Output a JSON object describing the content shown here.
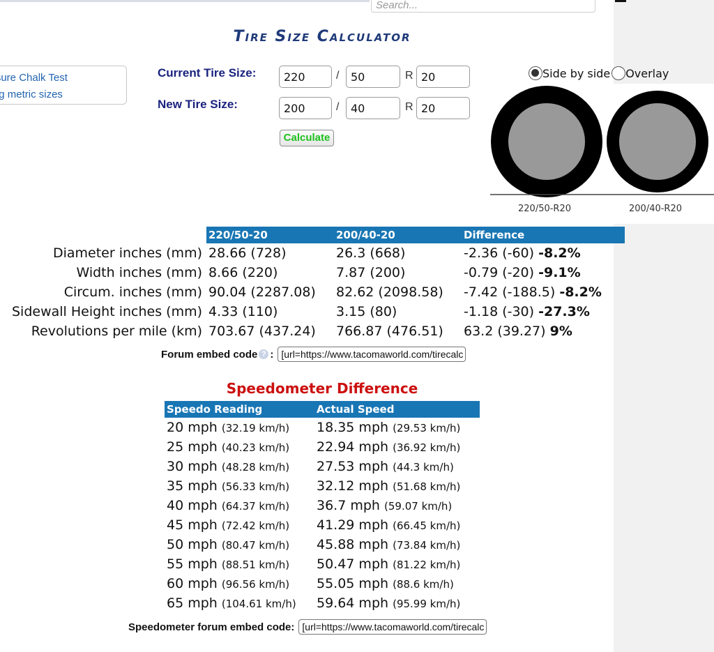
{
  "search": {
    "placeholder": "Search..."
  },
  "title": "Tire Size Calculator",
  "links": [
    "Pressure Chalk Test",
    "Understanding metric sizes"
  ],
  "form": {
    "current_label": "Current Tire Size:",
    "new_label": "New Tire Size:",
    "separator_slash": "/",
    "separator_r": "R",
    "current": {
      "width": "220",
      "aspect": "50",
      "rim": "20"
    },
    "new": {
      "width": "200",
      "aspect": "40",
      "rim": "20"
    },
    "calculate_label": "Calculate"
  },
  "view": {
    "side_by_side": "Side by side",
    "overlay": "Overlay",
    "selected": "side_by_side"
  },
  "tire_images": {
    "current_caption": "220/50-R20",
    "new_caption": "200/40-R20"
  },
  "comparison": {
    "headers": [
      "220/50-20",
      "200/40-20",
      "Difference"
    ],
    "rows": [
      {
        "label": "Diameter inches (mm)",
        "current": "28.66 (728)",
        "new": "26.3 (668)",
        "diff": "-2.36 (-60)",
        "pct": "-8.2%"
      },
      {
        "label": "Width inches (mm)",
        "current": "8.66 (220)",
        "new": "7.87 (200)",
        "diff": "-0.79 (-20)",
        "pct": "-9.1%"
      },
      {
        "label": "Circum. inches (mm)",
        "current": "90.04 (2287.08)",
        "new": "82.62 (2098.58)",
        "diff": "-7.42 (-188.5)",
        "pct": "-8.2%"
      },
      {
        "label": "Sidewall Height inches (mm)",
        "current": "4.33 (110)",
        "new": "3.15 (80)",
        "diff": "-1.18 (-30)",
        "pct": "-27.3%"
      },
      {
        "label": "Revolutions per mile (km)",
        "current": "703.67 (437.24)",
        "new": "766.87 (476.51)",
        "diff": "63.2 (39.27)",
        "pct": "9%"
      }
    ]
  },
  "forum_embed": {
    "label": "Forum embed code",
    "help": "?",
    "colon": ":",
    "value": "[url=https://www.tacomaworld.com/tirecalc"
  },
  "speedo": {
    "title": "Speedometer Difference",
    "headers": [
      "Speedo Reading",
      "Actual Speed"
    ],
    "rows": [
      {
        "reading": "20 mph",
        "reading_km": "(32.19 km/h)",
        "actual": "18.35 mph",
        "actual_km": "(29.53 km/h)"
      },
      {
        "reading": "25 mph",
        "reading_km": "(40.23 km/h)",
        "actual": "22.94 mph",
        "actual_km": "(36.92 km/h)"
      },
      {
        "reading": "30 mph",
        "reading_km": "(48.28 km/h)",
        "actual": "27.53 mph",
        "actual_km": "(44.3 km/h)"
      },
      {
        "reading": "35 mph",
        "reading_km": "(56.33 km/h)",
        "actual": "32.12 mph",
        "actual_km": "(51.68 km/h)"
      },
      {
        "reading": "40 mph",
        "reading_km": "(64.37 km/h)",
        "actual": "36.7 mph",
        "actual_km": "(59.07 km/h)"
      },
      {
        "reading": "45 mph",
        "reading_km": "(72.42 km/h)",
        "actual": "41.29 mph",
        "actual_km": "(66.45 km/h)"
      },
      {
        "reading": "50 mph",
        "reading_km": "(80.47 km/h)",
        "actual": "45.88 mph",
        "actual_km": "(73.84 km/h)"
      },
      {
        "reading": "55 mph",
        "reading_km": "(88.51 km/h)",
        "actual": "50.47 mph",
        "actual_km": "(81.22 km/h)"
      },
      {
        "reading": "60 mph",
        "reading_km": "(96.56 km/h)",
        "actual": "55.05 mph",
        "actual_km": "(88.6 km/h)"
      },
      {
        "reading": "65 mph",
        "reading_km": "(104.61 km/h)",
        "actual": "59.64 mph",
        "actual_km": "(95.99 km/h)"
      }
    ],
    "embed_label": "Speedometer forum embed code:",
    "embed_value": "[url=https://www.tacomaworld.com/tirecalc"
  },
  "colors": {
    "header_blue": "#1976b4",
    "title_navy": "#1f3a7a",
    "speedo_red": "#cc1010",
    "calc_green": "#1ec21e",
    "link_blue": "#2264b0"
  }
}
